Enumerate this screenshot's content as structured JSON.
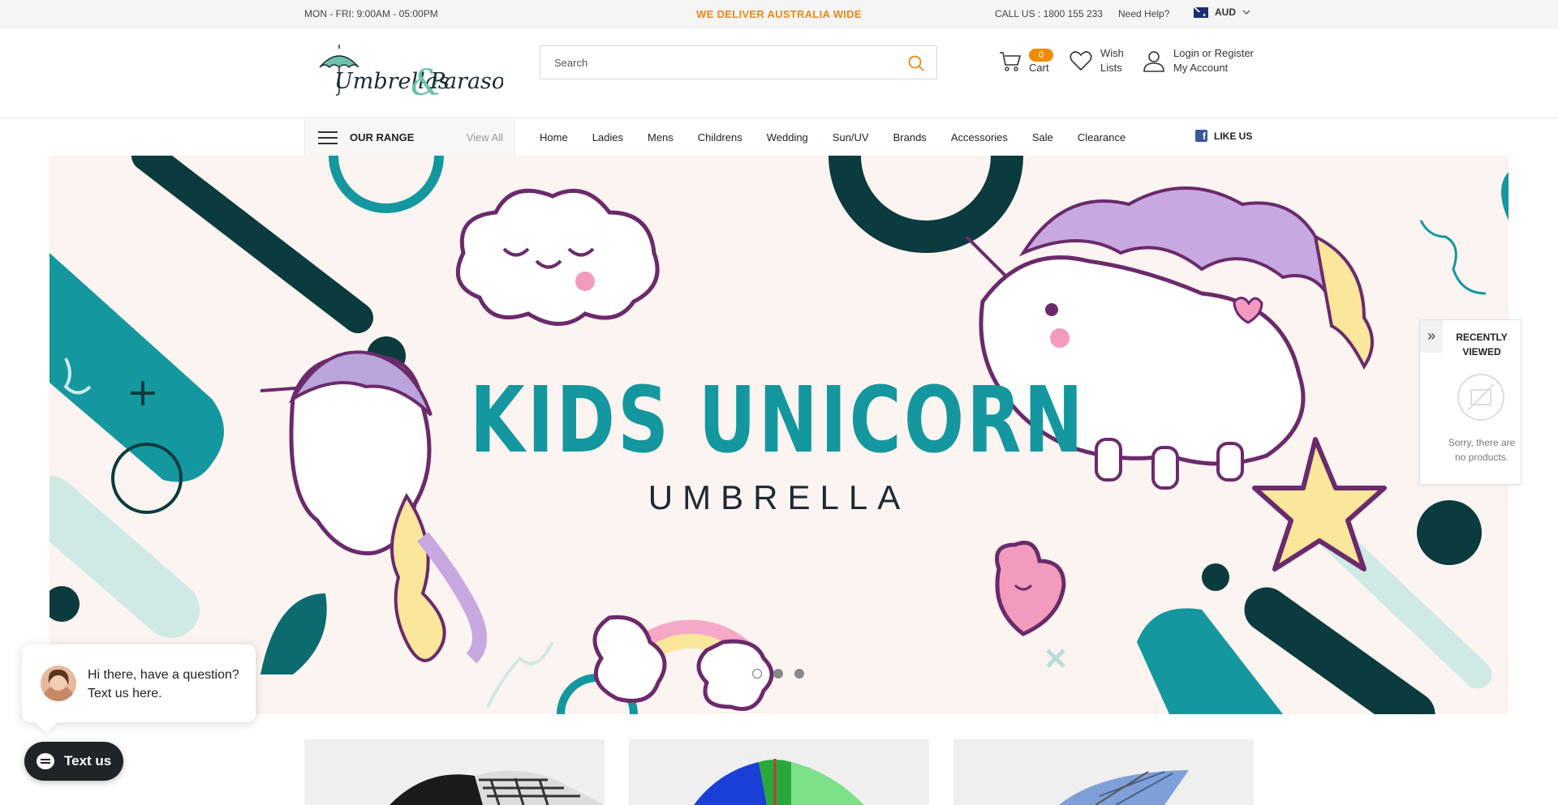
{
  "topbar": {
    "hours": "MON - FRI: 9:00AM - 05:00PM",
    "delivery": "WE DELIVER AUSTRALIA WIDE",
    "call": "CALL US : 1800 155 233",
    "help": "Need Help?",
    "currency": "AUD"
  },
  "header": {
    "logo_text": "Umbrellas & Parasols",
    "search_placeholder": "Search",
    "cart_count": "0",
    "cart_label": "Cart",
    "wish_line1": "Wish",
    "wish_line2": "Lists",
    "login_label": "Login or Register",
    "account_label": "My Account"
  },
  "nav": {
    "range_title": "OUR RANGE",
    "view_all": "View All",
    "items": [
      "Home",
      "Ladies",
      "Mens",
      "Childrens",
      "Wedding",
      "Sun/UV",
      "Brands",
      "Accessories",
      "Sale",
      "Clearance"
    ],
    "like_us": "LIKE US"
  },
  "hero": {
    "title": "KIDS UNICORN",
    "subtitle": "UMBRELLA",
    "slides": 3,
    "active_slide": 1
  },
  "recently_viewed": {
    "title": "RECENTLY VIEWED",
    "empty_message": "Sorry, there are no products."
  },
  "chat": {
    "message": "Hi there, have a question? Text us here.",
    "button_label": "Text us"
  },
  "colors": {
    "accent_orange": "#f08c00",
    "teal": "#14979f",
    "dark_teal": "#0b3b3e"
  }
}
